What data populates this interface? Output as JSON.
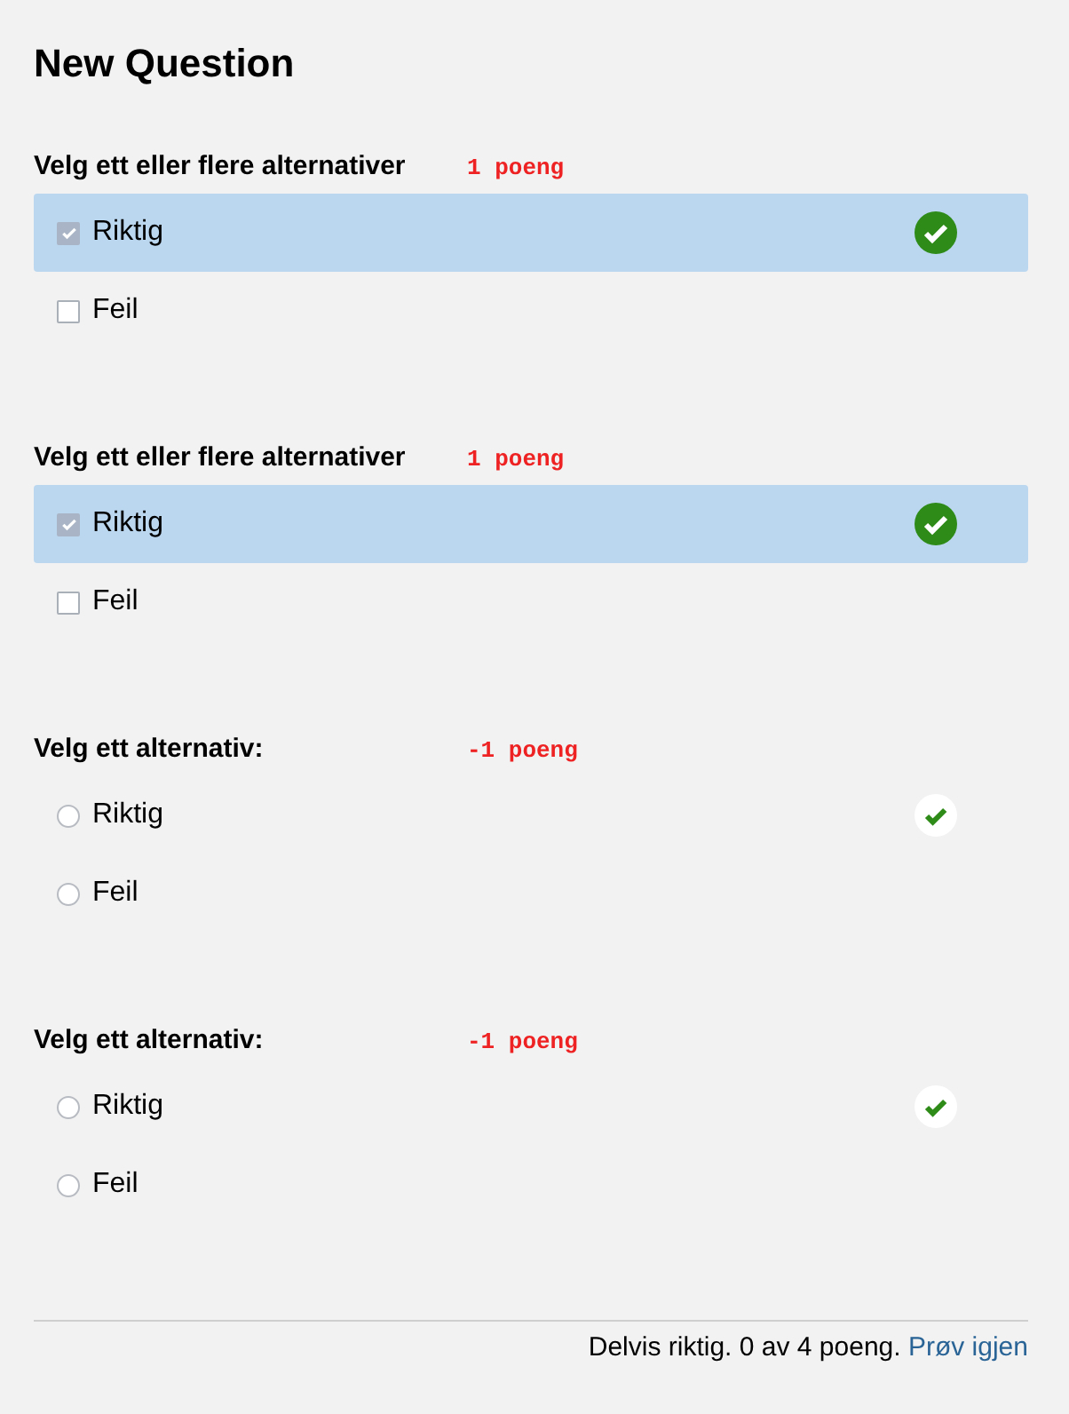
{
  "title": "New Question",
  "questions": [
    {
      "kind": "checkbox",
      "prompt": "Velg ett eller flere alternativer",
      "points": "1 poeng",
      "options": [
        {
          "label": "Riktig",
          "checked": true,
          "selected": true,
          "correct": true
        },
        {
          "label": "Feil",
          "checked": false,
          "selected": false,
          "correct": false
        }
      ]
    },
    {
      "kind": "checkbox",
      "prompt": "Velg ett eller flere alternativer",
      "points": "1 poeng",
      "options": [
        {
          "label": "Riktig",
          "checked": true,
          "selected": true,
          "correct": true
        },
        {
          "label": "Feil",
          "checked": false,
          "selected": false,
          "correct": false
        }
      ]
    },
    {
      "kind": "radio",
      "prompt": "Velg ett alternativ:",
      "points": "-1 poeng",
      "options": [
        {
          "label": "Riktig",
          "checked": false,
          "selected": false,
          "correct": true
        },
        {
          "label": "Feil",
          "checked": false,
          "selected": false,
          "correct": false
        }
      ]
    },
    {
      "kind": "radio",
      "prompt": "Velg ett alternativ:",
      "points": "-1 poeng",
      "options": [
        {
          "label": "Riktig",
          "checked": false,
          "selected": false,
          "correct": true
        },
        {
          "label": "Feil",
          "checked": false,
          "selected": false,
          "correct": false
        }
      ]
    }
  ],
  "footer": {
    "result": "Delvis riktig. 0 av 4 poeng.",
    "link": "Prøv igjen"
  }
}
